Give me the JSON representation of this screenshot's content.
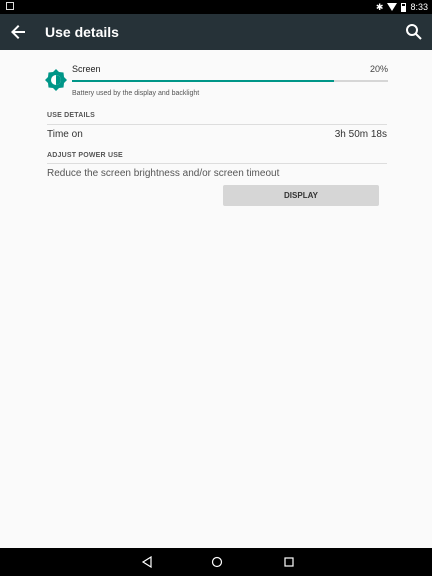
{
  "statusbar": {
    "time": "8:33",
    "icons": [
      "image-icon",
      "bluetooth-icon",
      "wifi-icon",
      "battery-icon"
    ]
  },
  "toolbar": {
    "title": "Use details",
    "back_icon": "arrow-back-icon",
    "search_icon": "search-icon"
  },
  "screen": {
    "label": "Screen",
    "percent": "20%",
    "usage_fraction": 0.83,
    "description": "Battery used by the display and backlight",
    "icon": "brightness-icon",
    "accent": "#009688"
  },
  "use_details": {
    "section_title": "USE DETAILS",
    "time_on_label": "Time on",
    "time_on_value": "3h 50m 18s"
  },
  "adjust": {
    "section_title": "ADJUST POWER USE",
    "text": "Reduce the screen brightness and/or screen timeout",
    "button_label": "DISPLAY"
  },
  "navbar": {
    "back_icon": "nav-back-icon",
    "home_icon": "nav-home-icon",
    "recent_icon": "nav-recent-icon"
  }
}
